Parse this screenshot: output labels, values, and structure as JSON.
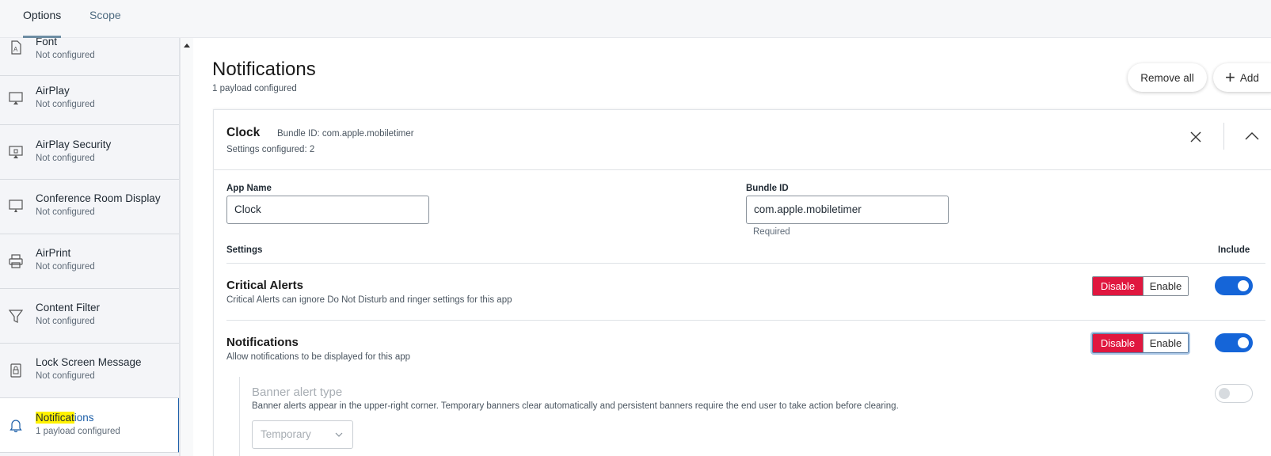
{
  "tabs": {
    "options": "Options",
    "scope": "Scope"
  },
  "sidebar": {
    "items": [
      {
        "title": "Font",
        "status": "Not configured",
        "icon": "font-icon"
      },
      {
        "title": "AirPlay",
        "status": "Not configured",
        "icon": "airplay-icon"
      },
      {
        "title": "AirPlay Security",
        "status": "Not configured",
        "icon": "airplay-security-icon"
      },
      {
        "title": "Conference Room Display",
        "status": "Not configured",
        "icon": "display-icon"
      },
      {
        "title": "AirPrint",
        "status": "Not configured",
        "icon": "printer-icon"
      },
      {
        "title": "Content Filter",
        "status": "Not configured",
        "icon": "filter-icon"
      },
      {
        "title": "Lock Screen Message",
        "status": "Not configured",
        "icon": "lock-screen-icon"
      },
      {
        "title_highlight": "Notificat",
        "title_rest": "ions",
        "status": "1 payload configured",
        "icon": "bell-icon"
      }
    ]
  },
  "main": {
    "title": "Notifications",
    "subtitle": "1 payload configured",
    "remove_all": "Remove all",
    "add": "Add"
  },
  "card": {
    "title": "Clock",
    "bundle": "Bundle ID: com.apple.mobiletimer",
    "settings_count": "Settings configured: 2",
    "app_name_label": "App Name",
    "app_name_value": "Clock",
    "bundle_label": "Bundle ID",
    "bundle_value": "com.apple.mobiletimer",
    "required": "Required",
    "settings_label": "Settings",
    "include_label": "Include"
  },
  "settings": {
    "critical": {
      "title": "Critical Alerts",
      "desc": "Critical Alerts can ignore Do Not Disturb and ringer settings for this app",
      "disable": "Disable",
      "enable": "Enable",
      "include": true
    },
    "notifications": {
      "title": "Notifications",
      "desc": "Allow notifications to be displayed for this app",
      "disable": "Disable",
      "enable": "Enable",
      "include": true
    },
    "banner": {
      "title": "Banner alert type",
      "desc": "Banner alerts appear in the upper-right corner. Temporary banners clear automatically and persistent banners require the end user to take action before clearing.",
      "select_value": "Temporary",
      "include": false
    }
  },
  "colors": {
    "accent": "#1565d8",
    "danger": "#e0173f",
    "highlight": "#fff200"
  }
}
